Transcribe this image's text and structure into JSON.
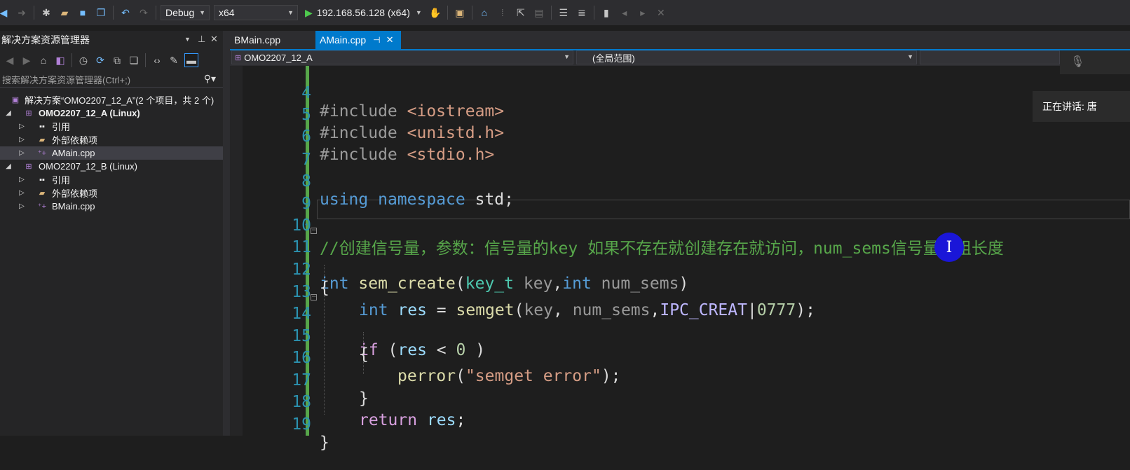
{
  "toolbar": {
    "config": "Debug",
    "platform": "x64",
    "run_target": "192.168.56.128 (x64)"
  },
  "solution_explorer": {
    "title": "解决方案资源管理器",
    "search_placeholder": "搜索解决方案资源管理器(Ctrl+;)",
    "solution_label": "解决方案“OMO2207_12_A”(2 个项目，共 2 个)",
    "items": [
      {
        "label": "OMO2207_12_A (Linux)"
      },
      {
        "label": "引用"
      },
      {
        "label": "外部依赖项"
      },
      {
        "label": "AMain.cpp"
      },
      {
        "label": "OMO2207_12_B (Linux)"
      },
      {
        "label": "引用"
      },
      {
        "label": "外部依赖项"
      },
      {
        "label": "BMain.cpp"
      }
    ]
  },
  "tabs": [
    {
      "label": "BMain.cpp",
      "active": false
    },
    {
      "label": "AMain.cpp",
      "active": true
    }
  ],
  "navbar": {
    "project": "OMO2207_12_A",
    "scope": "(全局范围)"
  },
  "editor": {
    "lines": [
      {
        "num": "4"
      },
      {
        "num": "5"
      },
      {
        "num": "6"
      },
      {
        "num": "7"
      },
      {
        "num": "8"
      },
      {
        "num": "9"
      },
      {
        "num": "10"
      },
      {
        "num": "11"
      },
      {
        "num": "12"
      },
      {
        "num": "13"
      },
      {
        "num": "14"
      },
      {
        "num": "15"
      },
      {
        "num": "16"
      },
      {
        "num": "17"
      },
      {
        "num": "18"
      },
      {
        "num": "19"
      }
    ],
    "code": {
      "l4_directive": "#include",
      "l4_header": "<iostream>",
      "l5_directive": "#include",
      "l5_header": "<unistd.h>",
      "l6_directive": "#include",
      "l6_header": "<stdio.h>",
      "l8_using": "using",
      "l8_namespace": "namespace",
      "l8_std": "std;",
      "l10_comment": "//创建信号量，参数：信号量的key 如果不存在就创建存在就访问，num_sems信号量数组长度",
      "l11_int": "int",
      "l11_fn": "sem_create",
      "l11_open": "(",
      "l11_type": "key_t",
      "l11_p1": "key",
      "l11_comma": ",",
      "l11_int2": "int",
      "l11_p2": "num_sems",
      "l11_close": ")",
      "l12": "{",
      "l13_int": "int",
      "l13_res": "res",
      "l13_eq": " = ",
      "l13_fn": "semget",
      "l13_open": "(",
      "l13_key": "key",
      "l13_comma": ", ",
      "l13_num": "num_sems",
      "l13_comma2": ",",
      "l13_macro": "IPC_CREAT",
      "l13_pipe": "|",
      "l13_lit": "0777",
      "l13_end": ");",
      "l14_if": "if",
      "l14_open": " (",
      "l14_res": "res",
      "l14_lt": " < ",
      "l14_zero": "0",
      "l14_close": " )",
      "l15": "{",
      "l16_fn": "perror",
      "l16_open": "(",
      "l16_str": "\"semget error\"",
      "l16_end": ");",
      "l17": "}",
      "l18_ret": "return",
      "l18_res": "res",
      "l18_end": ";",
      "l19": "}"
    }
  },
  "overlay": {
    "speaking_text": "正在讲话: 唐"
  }
}
